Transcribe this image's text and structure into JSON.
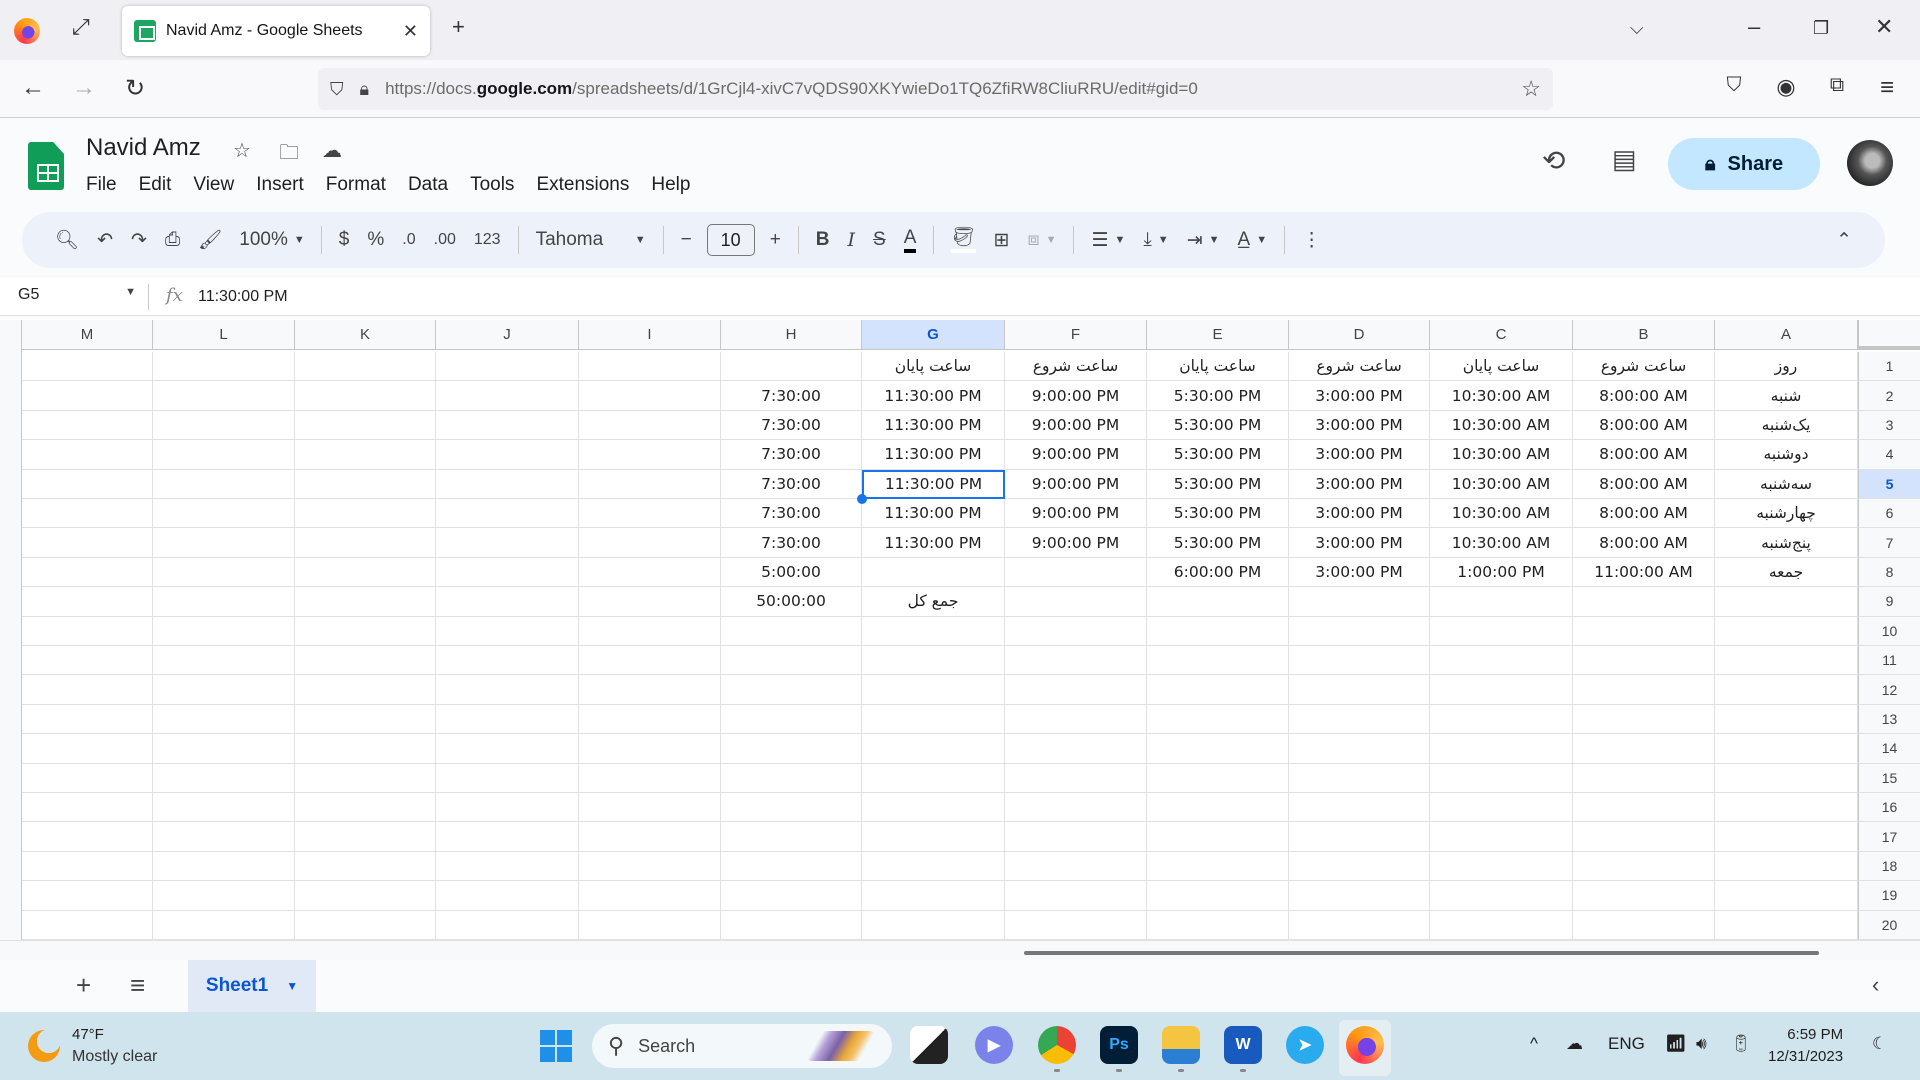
{
  "browser": {
    "tab_title": "Navid Amz - Google Sheets",
    "url_prefix": "https://docs.",
    "url_domain": "google.com",
    "url_suffix": "/spreadsheets/d/1GrCjl4-xivC7vQDS90XKYwieDo1TQ6ZfiRW8CliuRRU/edit#gid=0"
  },
  "app": {
    "doc_title": "Navid Amz",
    "menu": [
      "File",
      "Edit",
      "View",
      "Insert",
      "Format",
      "Data",
      "Tools",
      "Extensions",
      "Help"
    ],
    "share_label": "Share"
  },
  "toolbar": {
    "zoom": "100%",
    "currency": "$",
    "percent": "%",
    "decrease_decimal": ".0",
    "increase_decimal": ".00",
    "number_format": "123",
    "font": "Tahoma",
    "font_size": "10",
    "bold": "B",
    "italic": "I",
    "strike": "S",
    "text_color": "A"
  },
  "formula_bar": {
    "cell_ref": "G5",
    "value": "11:30:00 PM"
  },
  "sheet": {
    "columns": [
      "A",
      "B",
      "C",
      "D",
      "E",
      "F",
      "G",
      "H",
      "I",
      "J",
      "K",
      "L",
      "M"
    ],
    "selected_column": "G",
    "selected_row": 5,
    "rows": [
      [
        "روز",
        "ساعت شروع",
        "ساعت پایان",
        "ساعت شروع",
        "ساعت پایان",
        "ساعت شروع",
        "ساعت پایان",
        "",
        "",
        "",
        "",
        "",
        ""
      ],
      [
        "شنبه",
        "8:00:00 AM",
        "10:30:00 AM",
        "3:00:00 PM",
        "5:30:00 PM",
        "9:00:00 PM",
        "11:30:00 PM",
        "7:30:00",
        "",
        "",
        "",
        "",
        ""
      ],
      [
        "یک‌شنبه",
        "8:00:00 AM",
        "10:30:00 AM",
        "3:00:00 PM",
        "5:30:00 PM",
        "9:00:00 PM",
        "11:30:00 PM",
        "7:30:00",
        "",
        "",
        "",
        "",
        ""
      ],
      [
        "دوشنبه",
        "8:00:00 AM",
        "10:30:00 AM",
        "3:00:00 PM",
        "5:30:00 PM",
        "9:00:00 PM",
        "11:30:00 PM",
        "7:30:00",
        "",
        "",
        "",
        "",
        ""
      ],
      [
        "سه‌شنبه",
        "8:00:00 AM",
        "10:30:00 AM",
        "3:00:00 PM",
        "5:30:00 PM",
        "9:00:00 PM",
        "11:30:00 PM",
        "7:30:00",
        "",
        "",
        "",
        "",
        ""
      ],
      [
        "چهارشنبه",
        "8:00:00 AM",
        "10:30:00 AM",
        "3:00:00 PM",
        "5:30:00 PM",
        "9:00:00 PM",
        "11:30:00 PM",
        "7:30:00",
        "",
        "",
        "",
        "",
        ""
      ],
      [
        "پنج‌شنبه",
        "8:00:00 AM",
        "10:30:00 AM",
        "3:00:00 PM",
        "5:30:00 PM",
        "9:00:00 PM",
        "11:30:00 PM",
        "7:30:00",
        "",
        "",
        "",
        "",
        ""
      ],
      [
        "جمعه",
        "11:00:00 AM",
        "1:00:00 PM",
        "3:00:00 PM",
        "6:00:00 PM",
        "",
        "",
        "5:00:00",
        "",
        "",
        "",
        "",
        ""
      ],
      [
        "",
        "",
        "",
        "",
        "",
        "",
        "جمع کل",
        "50:00:00",
        "",
        "",
        "",
        "",
        ""
      ],
      [
        "",
        "",
        "",
        "",
        "",
        "",
        "",
        "",
        "",
        "",
        "",
        "",
        ""
      ],
      [
        "",
        "",
        "",
        "",
        "",
        "",
        "",
        "",
        "",
        "",
        "",
        "",
        ""
      ],
      [
        "",
        "",
        "",
        "",
        "",
        "",
        "",
        "",
        "",
        "",
        "",
        "",
        ""
      ],
      [
        "",
        "",
        "",
        "",
        "",
        "",
        "",
        "",
        "",
        "",
        "",
        "",
        ""
      ],
      [
        "",
        "",
        "",
        "",
        "",
        "",
        "",
        "",
        "",
        "",
        "",
        "",
        ""
      ],
      [
        "",
        "",
        "",
        "",
        "",
        "",
        "",
        "",
        "",
        "",
        "",
        "",
        ""
      ],
      [
        "",
        "",
        "",
        "",
        "",
        "",
        "",
        "",
        "",
        "",
        "",
        "",
        ""
      ],
      [
        "",
        "",
        "",
        "",
        "",
        "",
        "",
        "",
        "",
        "",
        "",
        "",
        ""
      ],
      [
        "",
        "",
        "",
        "",
        "",
        "",
        "",
        "",
        "",
        "",
        "",
        "",
        ""
      ],
      [
        "",
        "",
        "",
        "",
        "",
        "",
        "",
        "",
        "",
        "",
        "",
        "",
        ""
      ],
      [
        "",
        "",
        "",
        "",
        "",
        "",
        "",
        "",
        "",
        "",
        "",
        "",
        ""
      ]
    ],
    "tab_name": "Sheet1"
  },
  "taskbar": {
    "weather_temp": "47°F",
    "weather_desc": "Mostly clear",
    "search_label": "Search",
    "language": "ENG",
    "time": "6:59 PM",
    "date": "12/31/2023",
    "apps": [
      "task-view",
      "teams-meet",
      "chrome",
      "photoshop",
      "file-explorer",
      "word",
      "telegram",
      "firefox"
    ]
  },
  "colors": {
    "accent": "#0b57d0",
    "selection_border": "#1a73e8",
    "share_bg": "#c2e7ff",
    "sheets_green": "#0f9d58"
  }
}
